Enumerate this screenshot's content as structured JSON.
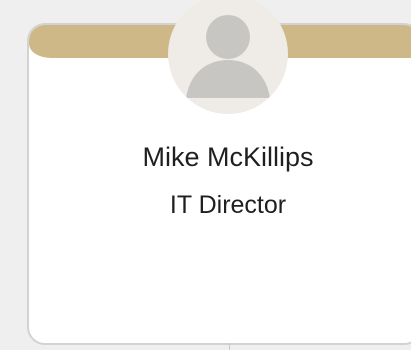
{
  "profile": {
    "name": "Mike McKillips",
    "title": "IT Director",
    "avatar_icon": "default-user-avatar-icon"
  },
  "colors": {
    "background": "#efefef",
    "card": "#ffffff",
    "accent_band": "#cfb887",
    "avatar_bg": "#efece8",
    "avatar_figure": "#c8c6c2",
    "text": "#1f1f1f"
  }
}
